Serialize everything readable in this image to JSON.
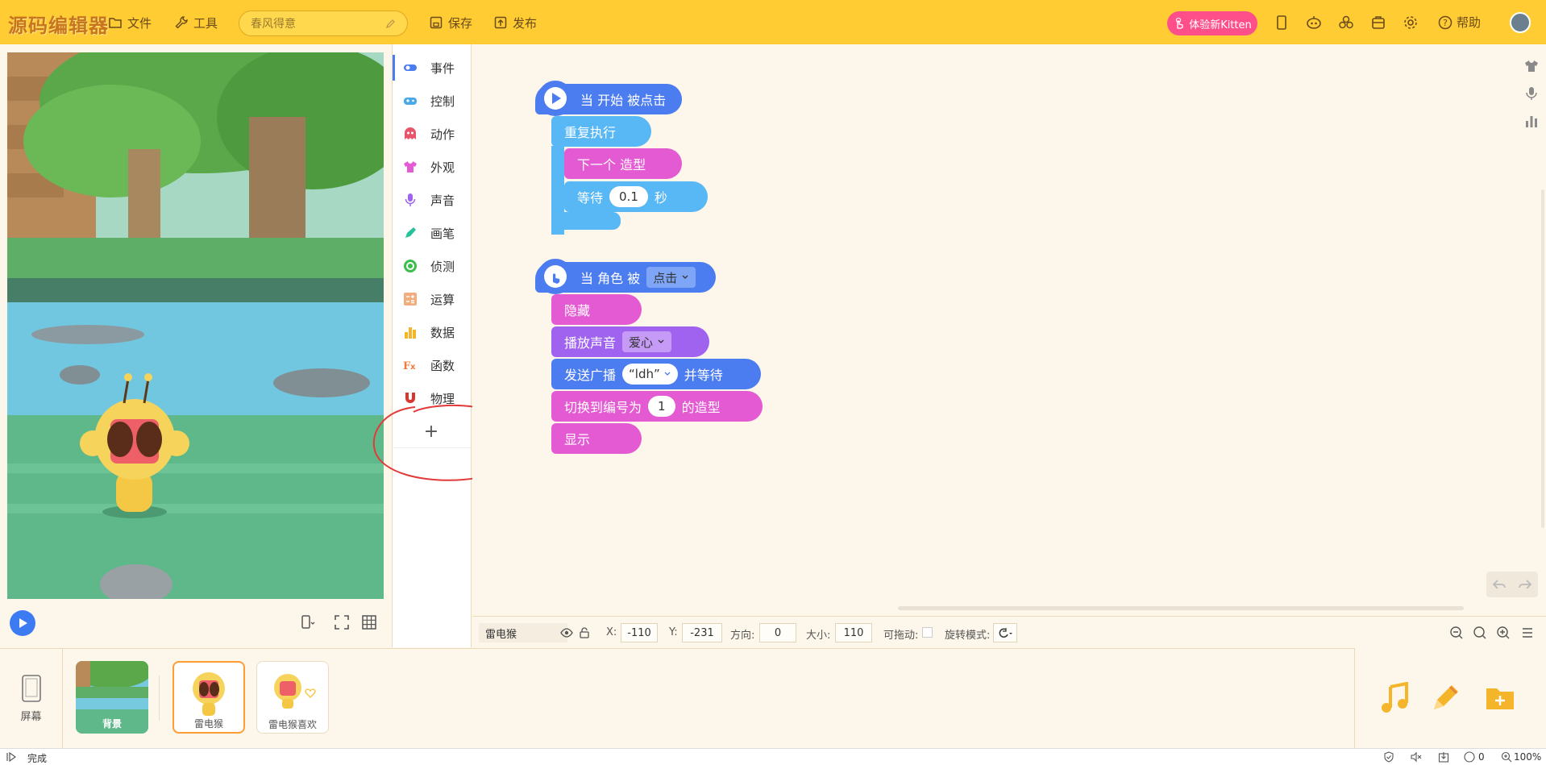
{
  "app": {
    "logo": "源码编辑器"
  },
  "toolbar": {
    "file": "文件",
    "tools": "工具",
    "project_name": "春风得意",
    "save": "保存",
    "publish": "发布",
    "kitten": "体验新Kitten",
    "help": "帮助"
  },
  "categories": [
    {
      "label": "事件",
      "color": "#4c7df0"
    },
    {
      "label": "控制",
      "color": "#4aa8e8"
    },
    {
      "label": "动作",
      "color": "#e8556b"
    },
    {
      "label": "外观",
      "color": "#e45ad2"
    },
    {
      "label": "声音",
      "color": "#a063f0"
    },
    {
      "label": "画笔",
      "color": "#26c29a"
    },
    {
      "label": "侦测",
      "color": "#3cbe4d"
    },
    {
      "label": "运算",
      "color": "#f2ad7e"
    },
    {
      "label": "数据",
      "color": "#f5b52a"
    },
    {
      "label": "函数",
      "color": "#f07a3c"
    },
    {
      "label": "物理",
      "color": "#d9362f"
    }
  ],
  "add_extension": "+",
  "script1": {
    "hat": "当 开始 被点击",
    "repeat": "重复执行",
    "next_costume": "下一个 造型",
    "wait": "等待",
    "wait_value": "0.1",
    "seconds": "秒"
  },
  "script2": {
    "hat": "当 角色 被",
    "hat_option": "点击",
    "hide": "隐藏",
    "play_sound": "播放声音",
    "sound_option": "爱心",
    "broadcast": "发送广播",
    "broadcast_option": "“ldh”",
    "and_wait": "并等待",
    "switch_costume": "切换到编号为",
    "costume_value": "1",
    "costume_suffix": "的造型",
    "show": "显示"
  },
  "props": {
    "sprite_name": "雷电猴",
    "x_label": "X:",
    "x_value": "-110",
    "y_label": "Y:",
    "y_value": "-231",
    "dir_label": "方向:",
    "dir_value": "0",
    "size_label": "大小:",
    "size_value": "110",
    "drag_label": "可拖动:",
    "rotate_label": "旋转模式:"
  },
  "sprites": {
    "screen": "屏幕",
    "bg": "背景",
    "s1": "雷电猴",
    "s2": "雷电猴喜欢"
  },
  "status": {
    "text": "完成",
    "count": "0",
    "zoom": "100%"
  }
}
